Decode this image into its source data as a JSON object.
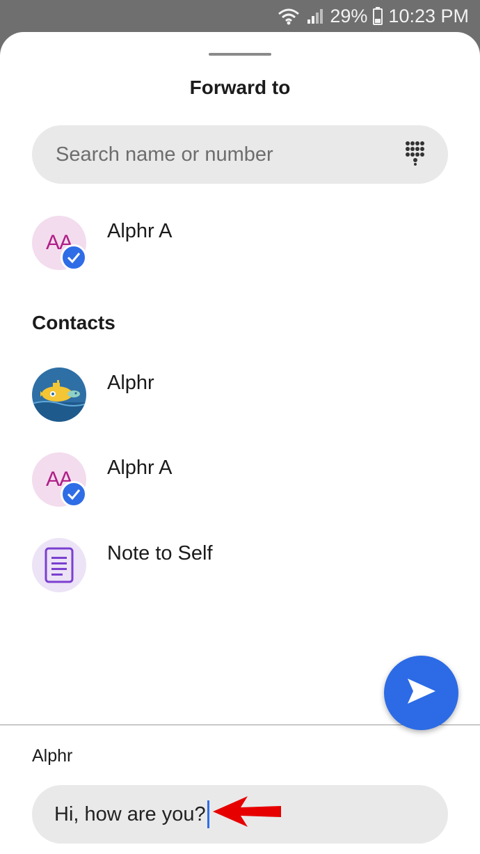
{
  "status_bar": {
    "battery_percent": "29%",
    "time": "10:23 PM",
    "icons": [
      "wifi-icon",
      "signal-icon",
      "battery-icon"
    ]
  },
  "sheet": {
    "title": "Forward to"
  },
  "search": {
    "placeholder": "Search name or number",
    "value": "",
    "keypad_icon": "dialpad-icon"
  },
  "selected": [
    {
      "name": "Alphr A",
      "initials": "AA",
      "selected": true
    }
  ],
  "contacts": {
    "header": "Contacts",
    "items": [
      {
        "name": "Alphr",
        "avatar": "submarine-image",
        "selected": false
      },
      {
        "name": "Alphr A",
        "initials": "AA",
        "selected": true
      },
      {
        "name": "Note to Self",
        "avatar": "note-icon",
        "selected": false
      }
    ]
  },
  "compose": {
    "recipient": "Alphr",
    "message": "Hi, how are you?",
    "send_icon": "send-icon"
  },
  "colors": {
    "accent": "#2c6be5",
    "avatar_pink": "#f3dcee",
    "avatar_text": "#b01e86",
    "field_bg": "#e9e9e9",
    "annotation_red": "#e60000"
  }
}
